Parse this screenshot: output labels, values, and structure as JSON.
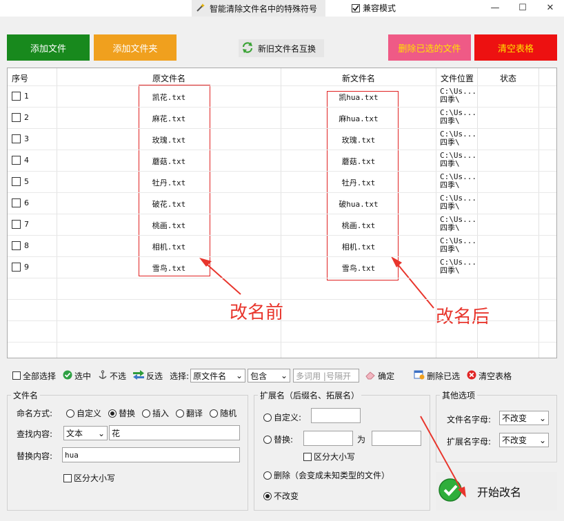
{
  "window": {
    "title": "智能清除文件名中的特殊符号",
    "compat_label": "兼容模式",
    "minimize": "—",
    "maximize": "☐",
    "close": "✕"
  },
  "top_buttons": {
    "add_file": "添加文件",
    "add_folder": "添加文件夹",
    "swap_names": "新旧文件名互换",
    "delete_selected": "删除已选的文件",
    "clear_table": "清空表格"
  },
  "table": {
    "headers": {
      "index": "序号",
      "old_name": "原文件名",
      "new_name": "新文件名",
      "location": "文件位置",
      "status": "状态"
    },
    "rows": [
      {
        "index": "1",
        "old": "凯花.txt",
        "new": "凯hua.txt",
        "loc1": "C:\\Us...",
        "loc2": "四季\\"
      },
      {
        "index": "2",
        "old": "麻花.txt",
        "new": "麻hua.txt",
        "loc1": "C:\\Us...",
        "loc2": "四季\\"
      },
      {
        "index": "3",
        "old": "玫瑰.txt",
        "new": "玫瑰.txt",
        "loc1": "C:\\Us...",
        "loc2": "四季\\"
      },
      {
        "index": "4",
        "old": "蘑菇.txt",
        "new": "蘑菇.txt",
        "loc1": "C:\\Us...",
        "loc2": "四季\\"
      },
      {
        "index": "5",
        "old": "牡丹.txt",
        "new": "牡丹.txt",
        "loc1": "C:\\Us...",
        "loc2": "四季\\"
      },
      {
        "index": "6",
        "old": "破花.txt",
        "new": "破hua.txt",
        "loc1": "C:\\Us...",
        "loc2": "四季\\"
      },
      {
        "index": "7",
        "old": "桃画.txt",
        "new": "桃画.txt",
        "loc1": "C:\\Us...",
        "loc2": "四季\\"
      },
      {
        "index": "8",
        "old": "相机.txt",
        "new": "相机.txt",
        "loc1": "C:\\Us...",
        "loc2": "四季\\"
      },
      {
        "index": "9",
        "old": "雪鸟.txt",
        "new": "雪鸟.txt",
        "loc1": "C:\\Us...",
        "loc2": "四季\\"
      }
    ],
    "annotation_before": "改名前",
    "annotation_after": "改名后"
  },
  "toolbar": {
    "select_all": "全部选择",
    "select": "选中",
    "unselect": "不选",
    "invert": "反选",
    "choose_label": "选择:",
    "field_value": "原文件名",
    "match_value": "包含",
    "keyword_placeholder": "多词用 |号隔开",
    "confirm": "确定",
    "delete_selected": "删除已选",
    "clear_table": "清空表格"
  },
  "filename_group": {
    "legend": "文件名",
    "mode_label": "命名方式:",
    "modes": [
      "自定义",
      "替换",
      "插入",
      "翻译",
      "随机"
    ],
    "selected_mode": "替换",
    "find_label": "查找内容:",
    "find_type": "文本",
    "find_value": "花",
    "replace_label": "替换内容:",
    "replace_value": "hua",
    "case_label": "区分大小写"
  },
  "ext_group": {
    "legend": "扩展名（后缀名、拓展名）",
    "custom_label": "自定义:",
    "replace_label": "替换:",
    "to_label": "为",
    "case_label": "区分大小写",
    "delete_label": "删除（会变成未知类型的文件）",
    "nochange_label": "不改变"
  },
  "other_group": {
    "legend": "其他选项",
    "fname_case_label": "文件名字母:",
    "fname_case_value": "不改变",
    "ext_case_label": "扩展名字母:",
    "ext_case_value": "不改变"
  },
  "start_button": "开始改名",
  "colors": {
    "green": "#18891d",
    "orange": "#f0a01e",
    "pink": "#ef5a86",
    "red": "#ed1111",
    "annotation": "#e8352c"
  }
}
